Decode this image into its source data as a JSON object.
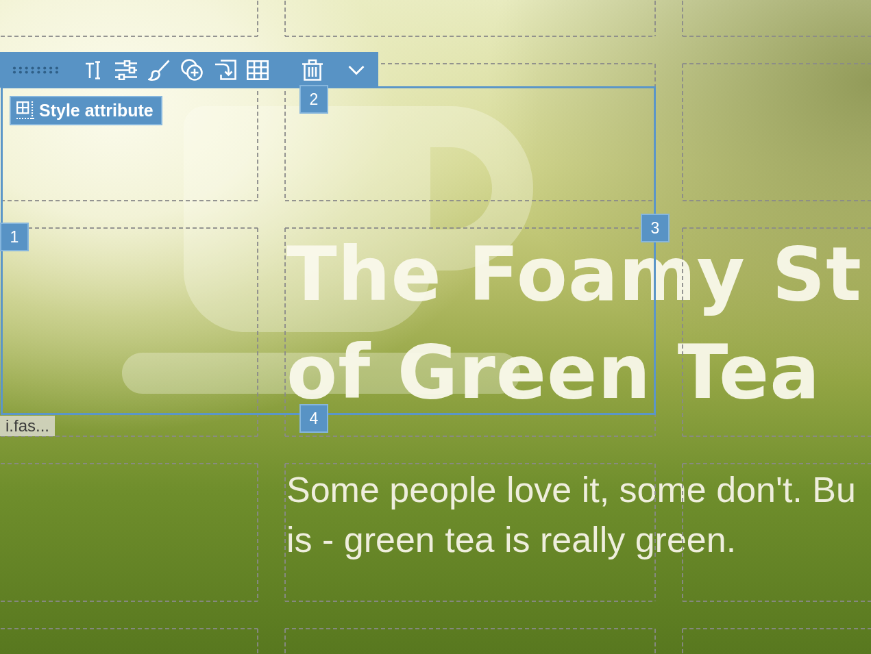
{
  "style_badge": {
    "label": "Style attribute"
  },
  "selection": {
    "handles": [
      "1",
      "2",
      "3",
      "4"
    ],
    "element_tag": "i.fas..."
  },
  "heading": {
    "lines": [
      "The Foamy St",
      "of Green Tea"
    ]
  },
  "paragraph": {
    "lines": [
      "Some people love it, some don't. Bu",
      "is - green tea is really green."
    ]
  }
}
